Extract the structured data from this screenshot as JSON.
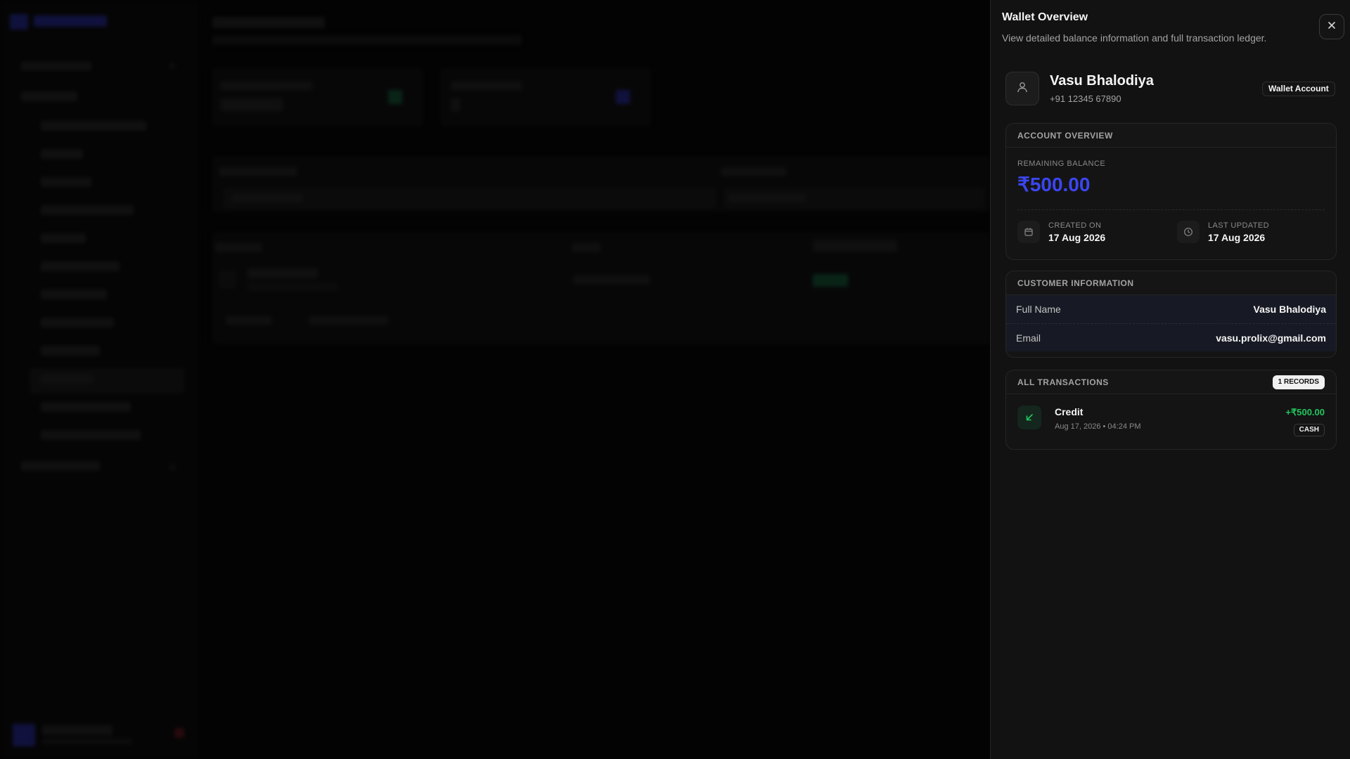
{
  "panel": {
    "title": "Wallet Overview",
    "subtitle": "View detailed balance information and full transaction ledger.",
    "close_icon": "close-icon"
  },
  "customer": {
    "name": "Vasu Bhalodiya",
    "phone": "+91 12345 67890",
    "badge": "Wallet Account",
    "avatar_icon": "user-icon"
  },
  "account_overview": {
    "heading": "ACCOUNT OVERVIEW",
    "balance_label": "REMAINING BALANCE",
    "balance_value": "₹500.00",
    "created_label": "CREATED ON",
    "created_value": "17 Aug 2026",
    "updated_label": "LAST UPDATED",
    "updated_value": "17 Aug 2026"
  },
  "customer_information": {
    "heading": "CUSTOMER INFORMATION",
    "rows": [
      {
        "key": "Full Name",
        "value": "Vasu Bhalodiya"
      },
      {
        "key": "Email",
        "value": "vasu.prolix@gmail.com"
      }
    ]
  },
  "transactions": {
    "heading": "ALL TRANSACTIONS",
    "count_badge": "1 RECORDS",
    "items": [
      {
        "type": "Credit",
        "datetime": "Aug 17, 2026 • 04:24 PM",
        "amount": "+₹500.00",
        "method": "CASH",
        "icon": "arrow-down-left-icon"
      }
    ]
  },
  "colors": {
    "accent_blue": "#3b46f0",
    "credit_green": "#22c55e",
    "panel_bg": "#121212"
  }
}
